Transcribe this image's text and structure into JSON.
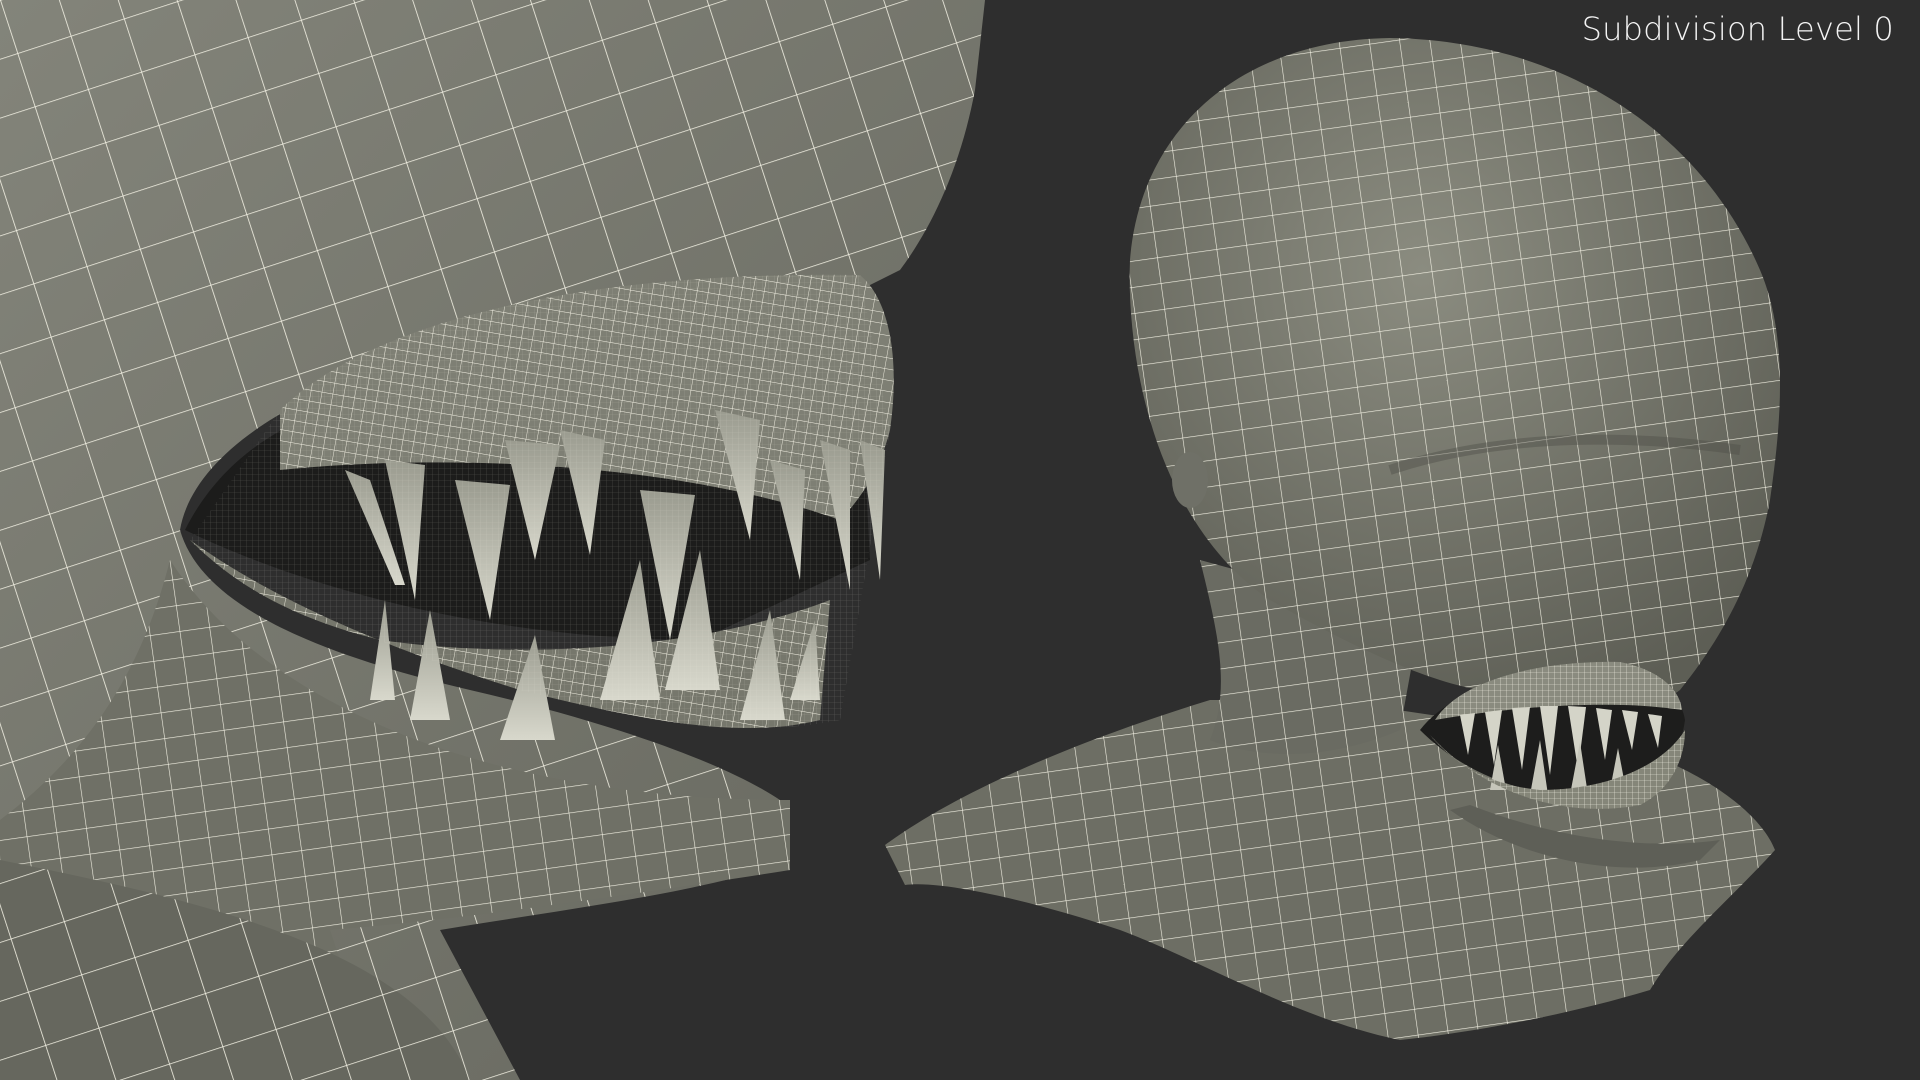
{
  "caption": "Subdivision Level 0",
  "colors": {
    "background": "#2e2e2e",
    "surface": "#7a7b6f",
    "surface_dark": "#4a4a44",
    "mouth_shadow": "#1c1c1b",
    "wire": "#f3f1e4",
    "teeth": "#c9c9bc"
  },
  "views": [
    {
      "name": "mouth-closeup",
      "subject": "creature-mouth"
    },
    {
      "name": "head-bust",
      "subject": "creature-head"
    }
  ]
}
